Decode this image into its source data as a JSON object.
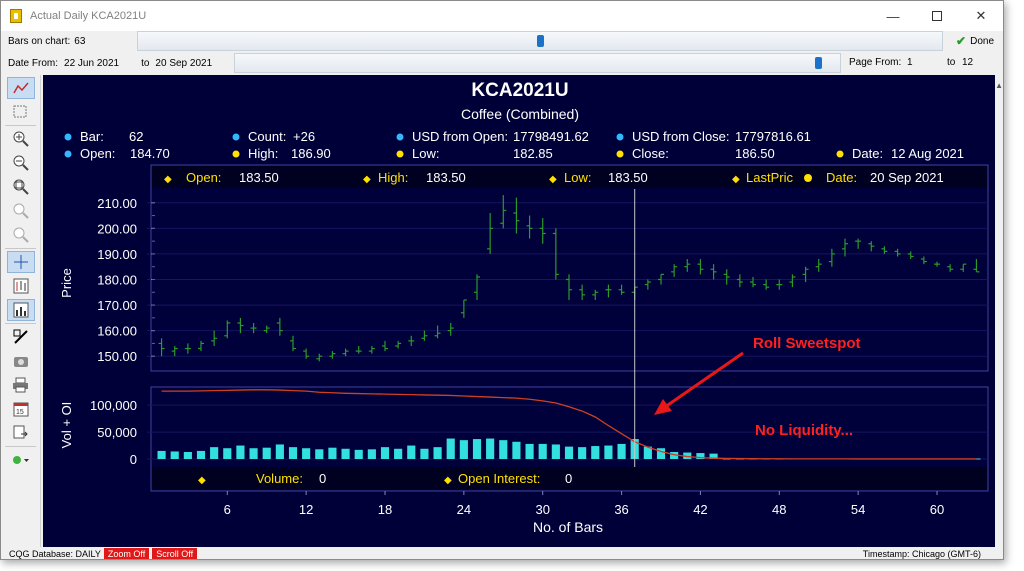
{
  "window": {
    "title": "Actual Daily KCA2021U",
    "minimize_icon": "minimize-icon",
    "maximize_icon": "maximize-icon",
    "close_icon": "close-icon"
  },
  "controls": {
    "bars_on_chart_label": "Bars on chart:",
    "bars_on_chart_value": "63",
    "bars_slider_level": 0.5,
    "done_label": "Done",
    "date_from_label": "Date From:",
    "date_from_value": "22 Jun 2021",
    "date_to_label": "to",
    "date_to_value": "20 Sep 2021",
    "date_slider_level": 0.97,
    "page_from_label": "Page From:",
    "page_from_value": "1",
    "page_to_label": "to",
    "page_to_value": "12"
  },
  "toolbar": {
    "icons": [
      "chart-type-icon",
      "select-icon",
      "zoom-in-icon",
      "zoom-out-icon",
      "zoom-fit-icon",
      "zoom-in-disabled-icon",
      "zoom-out-disabled-icon",
      "crosshair-icon",
      "bar-chart-icon",
      "volume-chart-icon",
      "draw-line-icon",
      "camera-icon",
      "printer-icon",
      "calendar-icon",
      "export-icon",
      "status-dot-icon"
    ]
  },
  "info": {
    "symbol": "KCA2021U",
    "market": "Coffee (Combined)",
    "bar_label": "Bar:",
    "bar_value": "62",
    "count_label": "Count:",
    "count_value": "+26",
    "usd_open_label": "USD from Open:",
    "usd_open_value": "17798491.62",
    "usd_close_label": "USD from Close:",
    "usd_close_value": "17797816.61",
    "open_label": "Open:",
    "open_value": "184.70",
    "high_label": "High:",
    "high_value": "186.90",
    "low_label": "Low:",
    "low_value": "182.85",
    "close_label": "Close:",
    "close_value": "186.50",
    "date_label": "Date:",
    "date_value": "12 Aug 2021"
  },
  "cursor_box": {
    "open_label": "Open:",
    "open_value": "183.50",
    "high_label": "High:",
    "high_value": "183.50",
    "low_label": "Low:",
    "low_value": "183.50",
    "lastprice_label": "LastPric",
    "date_label": "Date:",
    "date_value": "20 Sep 2021"
  },
  "volume_box": {
    "volume_label": "Volume:",
    "volume_value": "0",
    "oi_label": "Open Interest:",
    "oi_value": "0"
  },
  "annotations": {
    "roll_sweetspot": "Roll Sweetspot",
    "no_liquidity": "No Liquidity..."
  },
  "status": {
    "database": "CQG Database: DAILY",
    "zoom": "Zoom Off",
    "scroll": "Scroll Off",
    "timestamp": "Timestamp: Chicago (GMT-6)"
  },
  "colors": {
    "chart_bg": "#000038",
    "bar_color": "#2a9a2a",
    "volume_color": "#33e0e0",
    "oi_line": "#d04020",
    "label_yellow": "#ffe000",
    "accent_red": "#ff2020"
  },
  "chart_data": [
    {
      "type": "ohlc",
      "xlabel": "",
      "ylabel": "Price",
      "ylim": [
        145,
        215
      ],
      "yticks": [
        "150.00",
        "160.00",
        "170.00",
        "180.00",
        "190.00",
        "200.00",
        "210.00"
      ],
      "x": [
        1,
        2,
        3,
        4,
        5,
        6,
        7,
        8,
        9,
        10,
        11,
        12,
        13,
        14,
        15,
        16,
        17,
        18,
        19,
        20,
        21,
        22,
        23,
        24,
        25,
        26,
        27,
        28,
        29,
        30,
        31,
        32,
        33,
        34,
        35,
        36,
        37,
        38,
        39,
        40,
        41,
        42,
        43,
        44,
        45,
        46,
        47,
        48,
        49,
        50,
        51,
        52,
        53,
        54,
        55,
        56,
        57,
        58,
        59,
        60,
        61,
        62,
        63
      ],
      "open": [
        155,
        152,
        153,
        153,
        156,
        158,
        163,
        161,
        160,
        163,
        156,
        152,
        149,
        150,
        151,
        152,
        152,
        154,
        154,
        156,
        157,
        158,
        160,
        167,
        175,
        192,
        202,
        206,
        201,
        200,
        198,
        180,
        176,
        174,
        176,
        176,
        175,
        178,
        180,
        183,
        185,
        186,
        184,
        182,
        180,
        179,
        178,
        178,
        179,
        182,
        185,
        187,
        192,
        195,
        194,
        192,
        191,
        190,
        188,
        186,
        185,
        184,
        184
      ],
      "high": [
        157,
        154,
        155,
        156,
        160,
        164,
        165,
        163,
        162,
        165,
        158,
        153,
        151,
        152,
        153,
        154,
        154,
        156,
        156,
        158,
        160,
        162,
        163,
        172,
        182,
        206,
        213,
        212,
        205,
        204,
        200,
        182,
        178,
        176,
        178,
        178,
        177,
        180,
        182,
        186,
        188,
        188,
        186,
        184,
        182,
        181,
        180,
        180,
        182,
        185,
        188,
        192,
        196,
        196,
        195,
        193,
        192,
        191,
        189,
        187,
        186,
        186,
        188
      ],
      "low": [
        150,
        150,
        151,
        152,
        154,
        157,
        159,
        159,
        159,
        158,
        152,
        149,
        148,
        149,
        150,
        151,
        151,
        152,
        153,
        154,
        156,
        157,
        158,
        165,
        172,
        190,
        200,
        198,
        196,
        194,
        180,
        172,
        172,
        172,
        173,
        174,
        172,
        176,
        178,
        181,
        183,
        182,
        180,
        178,
        177,
        177,
        176,
        176,
        177,
        179,
        183,
        185,
        189,
        192,
        191,
        190,
        189,
        188,
        186,
        185,
        183,
        183,
        183
      ],
      "close": [
        153,
        153,
        153,
        155,
        157,
        163,
        162,
        161,
        161,
        160,
        153,
        150,
        150,
        151,
        152,
        152,
        153,
        153,
        155,
        156,
        158,
        159,
        161,
        172,
        181,
        200,
        207,
        203,
        200,
        198,
        182,
        176,
        174,
        175,
        176,
        175,
        177,
        179,
        182,
        185,
        186,
        184,
        183,
        181,
        179,
        178,
        177,
        178,
        181,
        184,
        186,
        190,
        194,
        195,
        193,
        191,
        190,
        189,
        187,
        186,
        184,
        186,
        183
      ]
    },
    {
      "type": "bar",
      "ylabel": "Vol + OI",
      "xlabel": "No. of Bars",
      "ylim": [
        0,
        130000
      ],
      "yticks": [
        "0",
        "50,000",
        "100,000"
      ],
      "xticks": [
        "6",
        "12",
        "18",
        "24",
        "30",
        "36",
        "42",
        "48",
        "54",
        "60"
      ],
      "series": [
        {
          "name": "Volume",
          "values": [
            15000,
            14000,
            13000,
            15000,
            22000,
            20000,
            25000,
            20000,
            21000,
            27000,
            22000,
            20000,
            18000,
            21000,
            19000,
            17000,
            18000,
            22000,
            19000,
            25000,
            19000,
            22000,
            38000,
            35000,
            37000,
            38000,
            35000,
            32000,
            28000,
            28000,
            27000,
            23000,
            22000,
            24000,
            25000,
            28000,
            37000,
            23000,
            20000,
            13000,
            12000,
            11000,
            10000,
            0,
            0,
            0,
            0,
            0,
            0,
            0,
            0,
            0,
            0,
            0,
            0,
            0,
            0,
            0,
            0,
            0,
            0,
            0,
            0
          ]
        },
        {
          "name": "Open Interest",
          "values": [
            126000,
            126000,
            126000,
            126500,
            127000,
            127500,
            128000,
            128500,
            128500,
            128000,
            127000,
            126000,
            124000,
            123000,
            122000,
            121500,
            121000,
            120500,
            120000,
            119500,
            119000,
            118500,
            118000,
            117000,
            116000,
            115000,
            114000,
            113000,
            111000,
            108000,
            104000,
            97000,
            89000,
            78000,
            62000,
            47000,
            32000,
            22000,
            14000,
            8000,
            4500,
            2500,
            1500,
            1000,
            800,
            600,
            500,
            400,
            300,
            200,
            200,
            200,
            200,
            100,
            100,
            100,
            100,
            100,
            100,
            100,
            100,
            100,
            100
          ]
        }
      ]
    }
  ]
}
